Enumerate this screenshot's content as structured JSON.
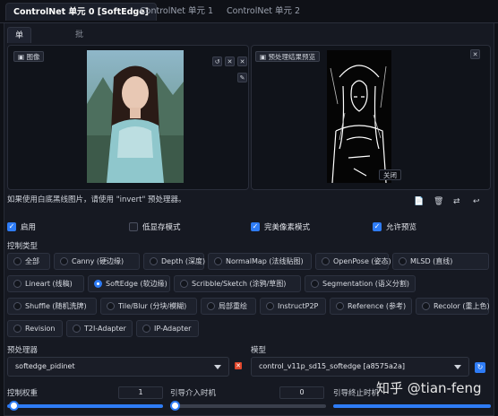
{
  "top_tabs": [
    "ControlNet 单元 0 [SoftEdge]",
    "ControlNet 单元 1",
    "ControlNet 单元 2"
  ],
  "sub_tabs": [
    "单张图片",
    "批量处理"
  ],
  "image_panel": {
    "image_label": "图像",
    "preview_button": "预处理结果预览",
    "close_label": "关闭"
  },
  "small_icons": [
    "↺",
    "✕",
    "✎",
    "↙"
  ],
  "hint": "如果使用白底黑线图片，请使用 \"invert\" 预处理器。",
  "tool_icons": [
    "📄",
    "🗑",
    "⇄",
    "↩"
  ],
  "checkboxes": [
    {
      "label": "启用",
      "checked": true
    },
    {
      "label": "低显存模式",
      "checked": false
    },
    {
      "label": "完美像素模式",
      "checked": true
    },
    {
      "label": "允许预览",
      "checked": true
    }
  ],
  "control_type_label": "控制类型",
  "control_types": [
    {
      "label": "全部",
      "selected": false
    },
    {
      "label": "Canny (硬边缘)",
      "selected": false
    },
    {
      "label": "Depth (深度)",
      "selected": false
    },
    {
      "label": "NormalMap (法线贴图)",
      "selected": false
    },
    {
      "label": "OpenPose (姿态)",
      "selected": false
    },
    {
      "label": "MLSD (直线)",
      "selected": false
    },
    {
      "label": "Lineart (线稿)",
      "selected": false
    },
    {
      "label": "SoftEdge (软边缘)",
      "selected": true
    },
    {
      "label": "Scribble/Sketch (涂鸦/草图)",
      "selected": false
    },
    {
      "label": "Segmentation (语义分割)",
      "selected": false
    },
    {
      "label": "Shuffle (随机洗牌)",
      "selected": false
    },
    {
      "label": "Tile/Blur (分块/模糊)",
      "selected": false
    },
    {
      "label": "局部重绘",
      "selected": false
    },
    {
      "label": "InstructP2P",
      "selected": false
    },
    {
      "label": "Reference (参考)",
      "selected": false
    },
    {
      "label": "Recolor (重上色)",
      "selected": false
    },
    {
      "label": "Revision",
      "selected": false
    },
    {
      "label": "T2I-Adapter",
      "selected": false
    },
    {
      "label": "IP-Adapter",
      "selected": false
    }
  ],
  "preprocessor": {
    "label": "预处理器",
    "value": "softedge_pidinet"
  },
  "model": {
    "label": "模型",
    "value": "control_v11p_sd15_softedge [a8575a2a]"
  },
  "weight": {
    "label": "控制权重",
    "value": "1"
  },
  "start_step": {
    "label": "引导介入时机",
    "value": "0"
  },
  "end_step": {
    "label": "引导终止时机"
  },
  "watermark": "知乎 @tian-feng",
  "colors": {
    "accent": "#2e7cf6",
    "background": "#0f1117",
    "panel": "#161922"
  }
}
